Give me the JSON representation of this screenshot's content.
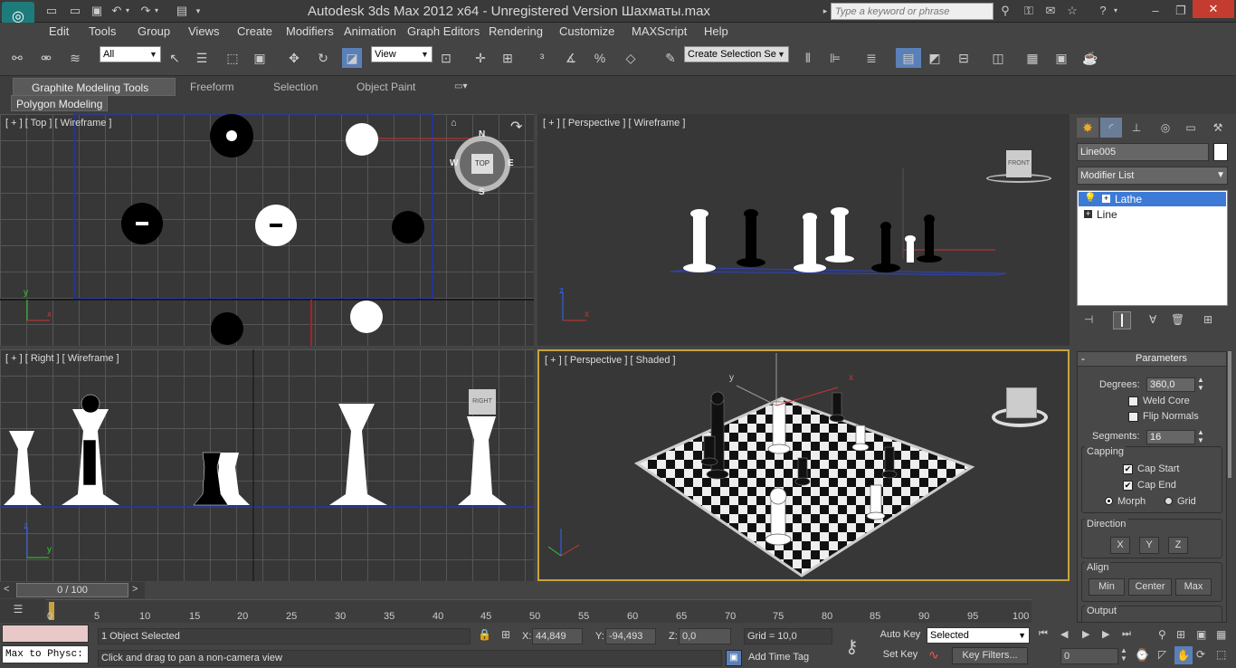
{
  "window": {
    "title": "Autodesk 3ds Max  2012 x64   - Unregistered Version    Шахматы.max",
    "search_placeholder": "Type a keyword or phrase"
  },
  "menu": [
    "Edit",
    "Tools",
    "Group",
    "Views",
    "Create",
    "Modifiers",
    "Animation",
    "Graph Editors",
    "Rendering",
    "Customize",
    "MAXScript",
    "Help"
  ],
  "toolbar": {
    "filter_value": "All",
    "ref_coord_value": "View",
    "selection_set_value": "Create Selection Se"
  },
  "ribbon": {
    "tabs": [
      "Graphite Modeling Tools",
      "Freeform",
      "Selection",
      "Object Paint"
    ],
    "sub_label": "Polygon Modeling"
  },
  "viewports": {
    "top_left": "[ + ] [ Top ] [ Wireframe ]",
    "top_right": "[ + ] [ Perspective ] [ Wireframe ]",
    "bottom_left": "[ + ] [ Right ] [ Wireframe ]",
    "bottom_right": "[ + ] [ Perspective ] [ Shaded ]",
    "viewcube_top": "TOP",
    "viewcube_front": "FRONT",
    "viewcube_right": "RIGHT",
    "compass": [
      "N",
      "S",
      "W",
      "E"
    ],
    "axis_labels": {
      "x": "x",
      "y": "y",
      "z": "z"
    }
  },
  "command_panel": {
    "object_name": "Line005",
    "modifier_list": "Modifier List",
    "stack": [
      "Lathe",
      "Line"
    ],
    "rollout_title": "Parameters",
    "degrees_label": "Degrees:",
    "degrees_value": "360,0",
    "weld_core": "Weld Core",
    "flip_normals": "Flip Normals",
    "segments_label": "Segments:",
    "segments_value": "16",
    "capping_label": "Capping",
    "cap_start": "Cap Start",
    "cap_end": "Cap End",
    "morph": "Morph",
    "grid": "Grid",
    "direction_label": "Direction",
    "dir_buttons": [
      "X",
      "Y",
      "Z"
    ],
    "align_label": "Align",
    "align_buttons": [
      "Min",
      "Center",
      "Max"
    ],
    "output_label": "Output",
    "weld_core_checked": false,
    "flip_normals_checked": false,
    "cap_start_checked": true,
    "cap_end_checked": true,
    "selected_cap_type": "Morph"
  },
  "timeline": {
    "frame_label": "0 / 100",
    "ticks": [
      "0",
      "5",
      "10",
      "15",
      "20",
      "25",
      "30",
      "35",
      "40",
      "45",
      "50",
      "55",
      "60",
      "65",
      "70",
      "75",
      "80",
      "85",
      "90",
      "95",
      "100"
    ]
  },
  "status": {
    "maxscript_text": "Max to Physc:",
    "selection_text": "1 Object Selected",
    "prompt_text": "Click and drag to pan a non-camera view",
    "x_label": "X:",
    "x_value": "44,849",
    "y_label": "Y:",
    "y_value": "-94,493",
    "z_label": "Z:",
    "z_value": "0,0",
    "grid_text": "Grid = 10,0",
    "auto_key": "Auto Key",
    "set_key": "Set Key",
    "selected_value": "Selected",
    "key_filters": "Key Filters...",
    "add_time_tag": "Add Time Tag",
    "frame_value": "0"
  }
}
